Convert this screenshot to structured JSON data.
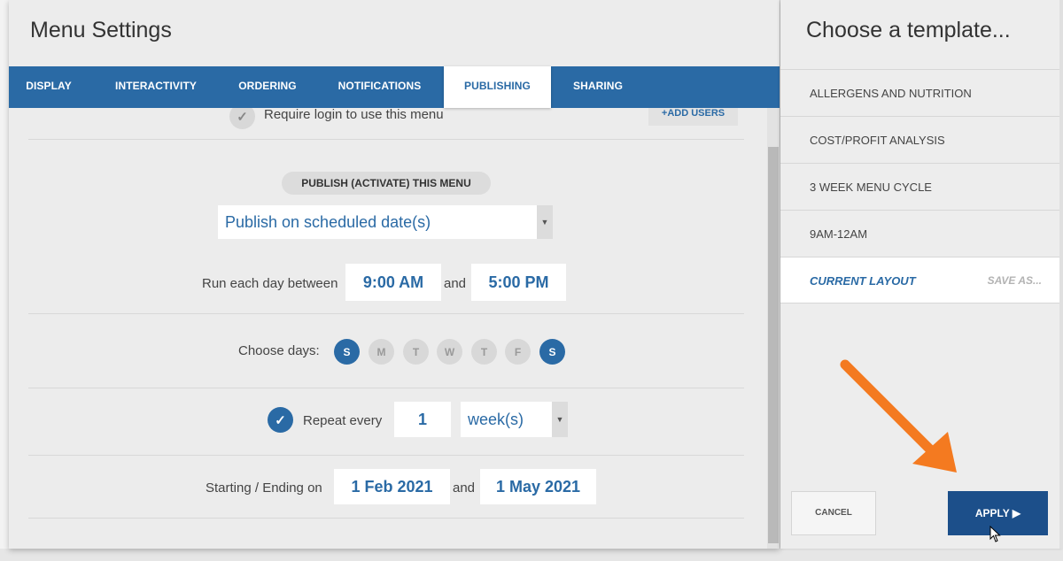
{
  "menu_settings": {
    "title": "Menu Settings",
    "tabs": [
      {
        "label": "DISPLAY"
      },
      {
        "label": "INTERACTIVITY"
      },
      {
        "label": "ORDERING"
      },
      {
        "label": "NOTIFICATIONS"
      },
      {
        "label": "PUBLISHING",
        "active": true
      },
      {
        "label": "SHARING"
      }
    ],
    "login": {
      "label": "Require login to use this menu",
      "checked": false
    },
    "add_users_label": "+ADD USERS",
    "publish": {
      "heading": "PUBLISH (ACTIVATE) THIS MENU",
      "mode_value": "Publish on scheduled date(s)"
    },
    "run_time": {
      "label": "Run each day between",
      "start": "9:00 AM",
      "and_label": "and",
      "end": "5:00 PM"
    },
    "days": {
      "label": "Choose days:",
      "items": [
        {
          "letter": "S",
          "selected": true
        },
        {
          "letter": "M",
          "selected": false
        },
        {
          "letter": "T",
          "selected": false
        },
        {
          "letter": "W",
          "selected": false
        },
        {
          "letter": "T",
          "selected": false
        },
        {
          "letter": "F",
          "selected": false
        },
        {
          "letter": "S",
          "selected": true
        }
      ]
    },
    "repeat": {
      "checked": true,
      "label": "Repeat every",
      "count": "1",
      "unit": "week(s)"
    },
    "date_range": {
      "label": "Starting / Ending on",
      "start": "1 Feb 2021",
      "and_label": "and",
      "end": "1 May 2021"
    }
  },
  "template_panel": {
    "title": "Choose a template...",
    "templates": [
      {
        "label": "ALLERGENS AND NUTRITION"
      },
      {
        "label": "COST/PROFIT ANALYSIS"
      },
      {
        "label": "3 WEEK MENU CYCLE"
      },
      {
        "label": "9AM-12AM"
      }
    ],
    "current_label": "CURRENT LAYOUT",
    "save_as_label": "SAVE AS...",
    "cancel_label": "CANCEL",
    "apply_label": "APPLY ▶"
  },
  "colors": {
    "accent": "#2a6aa5",
    "apply_button": "#1c4f8a",
    "annotation_arrow": "#f47a20"
  }
}
